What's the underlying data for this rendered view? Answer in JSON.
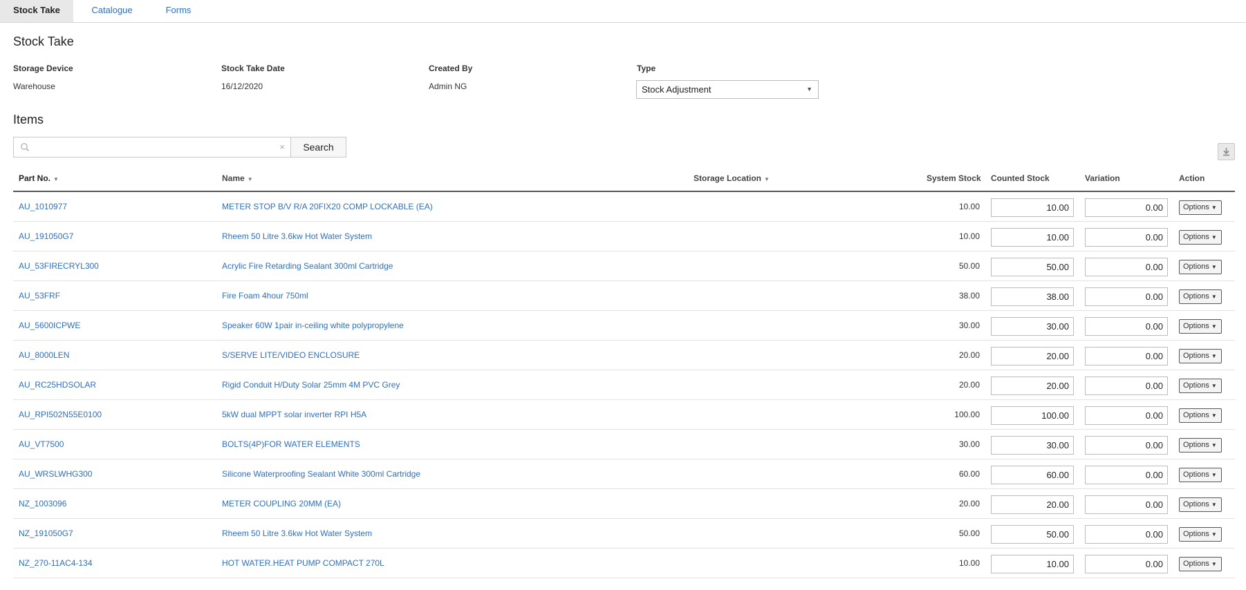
{
  "tabs": [
    {
      "label": "Stock Take",
      "active": true
    },
    {
      "label": "Catalogue",
      "active": false
    },
    {
      "label": "Forms",
      "active": false
    }
  ],
  "page_title": "Stock Take",
  "meta": {
    "storage_device": {
      "label": "Storage Device",
      "value": "Warehouse"
    },
    "stock_take_date": {
      "label": "Stock Take Date",
      "value": "16/12/2020"
    },
    "created_by": {
      "label": "Created By",
      "value": "Admin NG"
    },
    "type": {
      "label": "Type",
      "value": "Stock Adjustment"
    }
  },
  "items_title": "Items",
  "search": {
    "value": "",
    "placeholder": "",
    "button_label": "Search",
    "clear_glyph": "×"
  },
  "icons": {
    "search": "search-icon",
    "clear": "close-icon",
    "download": "download-icon",
    "caret": "chevron-down-icon"
  },
  "columns": {
    "part_no": "Part No.",
    "name": "Name",
    "storage_location": "Storage Location",
    "system_stock": "System Stock",
    "counted_stock": "Counted Stock",
    "variation": "Variation",
    "action": "Action"
  },
  "options_label": "Options",
  "rows": [
    {
      "part_no": "AU_1010977",
      "name": "METER STOP B/V R/A 20FIX20 COMP LOCKABLE (EA)",
      "storage_location": "",
      "system_stock": "10.00",
      "counted_stock": "10.00",
      "variation": "0.00"
    },
    {
      "part_no": "AU_191050G7",
      "name": "Rheem 50 Litre 3.6kw Hot Water System",
      "storage_location": "",
      "system_stock": "10.00",
      "counted_stock": "10.00",
      "variation": "0.00"
    },
    {
      "part_no": "AU_53FIRECRYL300",
      "name": "Acrylic Fire Retarding Sealant 300ml Cartridge",
      "storage_location": "",
      "system_stock": "50.00",
      "counted_stock": "50.00",
      "variation": "0.00"
    },
    {
      "part_no": "AU_53FRF",
      "name": "Fire Foam 4hour 750ml",
      "storage_location": "",
      "system_stock": "38.00",
      "counted_stock": "38.00",
      "variation": "0.00"
    },
    {
      "part_no": "AU_5600ICPWE",
      "name": "Speaker 60W 1pair in-ceiling white polypropylene",
      "storage_location": "",
      "system_stock": "30.00",
      "counted_stock": "30.00",
      "variation": "0.00"
    },
    {
      "part_no": "AU_8000LEN",
      "name": "S/SERVE LITE/VIDEO ENCLOSURE",
      "storage_location": "",
      "system_stock": "20.00",
      "counted_stock": "20.00",
      "variation": "0.00"
    },
    {
      "part_no": "AU_RC25HDSOLAR",
      "name": "Rigid Conduit H/Duty Solar 25mm 4M PVC Grey",
      "storage_location": "",
      "system_stock": "20.00",
      "counted_stock": "20.00",
      "variation": "0.00"
    },
    {
      "part_no": "AU_RPI502N55E0100",
      "name": "5kW dual MPPT solar inverter RPI H5A",
      "storage_location": "",
      "system_stock": "100.00",
      "counted_stock": "100.00",
      "variation": "0.00"
    },
    {
      "part_no": "AU_VT7500",
      "name": "BOLTS(4P)FOR WATER ELEMENTS",
      "storage_location": "",
      "system_stock": "30.00",
      "counted_stock": "30.00",
      "variation": "0.00"
    },
    {
      "part_no": "AU_WRSLWHG300",
      "name": "Silicone Waterproofing Sealant White 300ml Cartridge",
      "storage_location": "",
      "system_stock": "60.00",
      "counted_stock": "60.00",
      "variation": "0.00"
    },
    {
      "part_no": "NZ_1003096",
      "name": "METER COUPLING 20MM (EA)",
      "storage_location": "",
      "system_stock": "20.00",
      "counted_stock": "20.00",
      "variation": "0.00"
    },
    {
      "part_no": "NZ_191050G7",
      "name": "Rheem 50 Litre 3.6kw Hot Water System",
      "storage_location": "",
      "system_stock": "50.00",
      "counted_stock": "50.00",
      "variation": "0.00"
    },
    {
      "part_no": "NZ_270-11AC4-134",
      "name": "HOT WATER.HEAT PUMP COMPACT 270L",
      "storage_location": "",
      "system_stock": "10.00",
      "counted_stock": "10.00",
      "variation": "0.00"
    }
  ]
}
